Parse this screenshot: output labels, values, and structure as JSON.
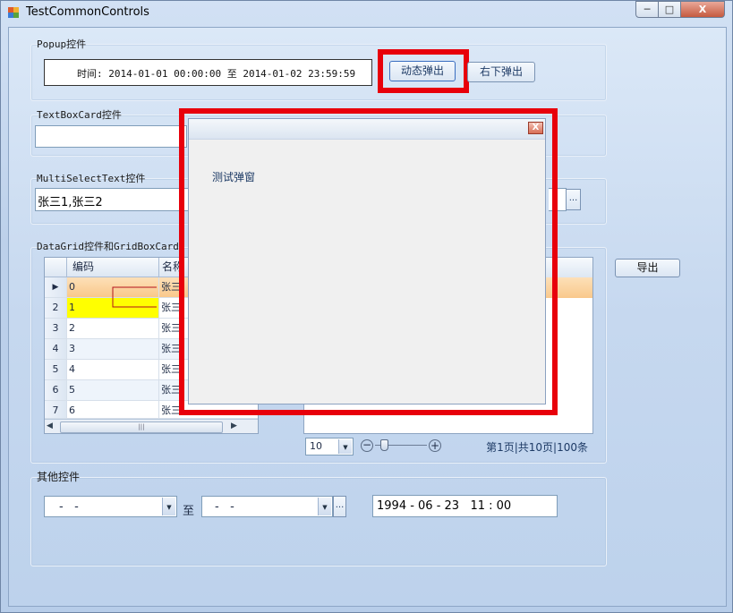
{
  "window": {
    "title": "TestCommonControls",
    "buttons": {
      "minimize": "─",
      "maximize": "□",
      "close": "X"
    }
  },
  "popup_group": {
    "label": "Popup控件",
    "time_text": "时间: 2014-01-01 00:00:00 至 2014-01-02 23:59:59",
    "dynamic_popup_label": "动态弹出",
    "bottom_right_popup_label": "右下弹出"
  },
  "textboxcard_group": {
    "label": "TextBoxCard控件",
    "value": ""
  },
  "multiselect_group": {
    "label": "MultiSelectText控件",
    "value": "张三1,张三2",
    "browse": "..."
  },
  "datagrid_group": {
    "label": "DataGrid控件和GridBoxCard控件",
    "columns": [
      "编码",
      "名称"
    ],
    "rows": [
      {
        "num": "",
        "code": "0",
        "name": "张三"
      },
      {
        "num": "2",
        "code": "1",
        "name": "张三"
      },
      {
        "num": "3",
        "code": "2",
        "name": "张三"
      },
      {
        "num": "4",
        "code": "3",
        "name": "张三"
      },
      {
        "num": "5",
        "code": "4",
        "name": "张三"
      },
      {
        "num": "6",
        "code": "5",
        "name": "张三"
      },
      {
        "num": "7",
        "code": "6",
        "name": "张三"
      }
    ],
    "scroll_mark": "|||",
    "page_size": "10",
    "pager_text": "第1页|共10页|100条",
    "export_label": "导出"
  },
  "other_group": {
    "label": "其他控件",
    "date_from": "-   -",
    "to_label": "至",
    "date_to": "-   -",
    "browse": "...",
    "datetime_value": "1994 - 06 - 23   11 : 00"
  },
  "popup_window": {
    "content_text": "测试弹窗",
    "close": "X"
  },
  "colors": {
    "highlight": "#e8000b",
    "selected_row": "#fbd7a8",
    "yellow_row": "#ffff00"
  }
}
